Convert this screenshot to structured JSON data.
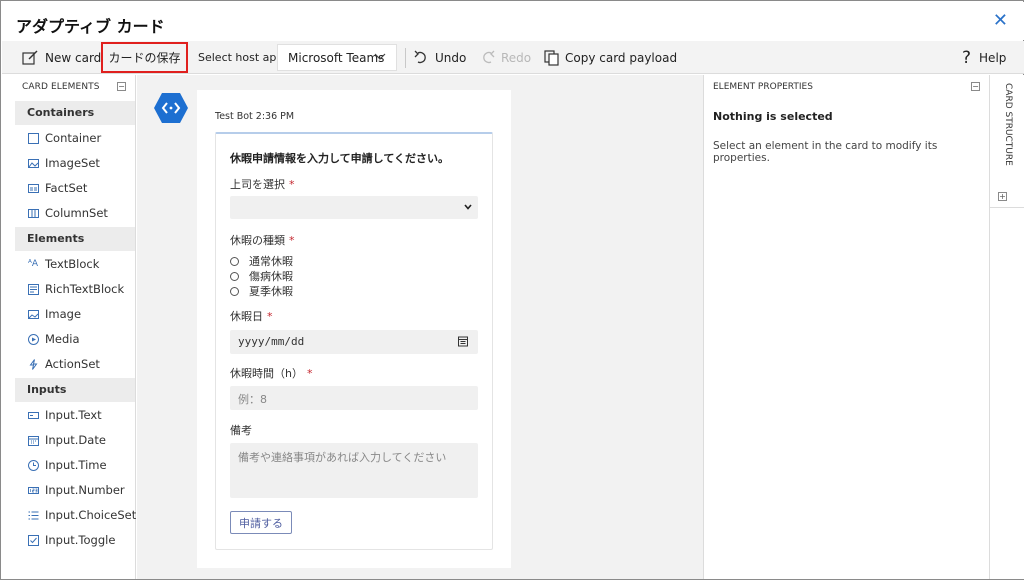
{
  "app": {
    "title": "アダプティブ カード"
  },
  "toolbar": {
    "new_card": "New card",
    "save_card": "カードの保存",
    "host_label": "Select host app:",
    "host_value": "Microsoft Teams",
    "undo": "Undo",
    "redo": "Redo",
    "copy_payload": "Copy card payload",
    "help": "Help"
  },
  "card_elements": {
    "header": "CARD ELEMENTS",
    "groups": [
      {
        "label": "Containers",
        "items": [
          "Container",
          "ImageSet",
          "FactSet",
          "ColumnSet"
        ]
      },
      {
        "label": "Elements",
        "items": [
          "TextBlock",
          "RichTextBlock",
          "Image",
          "Media",
          "ActionSet"
        ]
      },
      {
        "label": "Inputs",
        "items": [
          "Input.Text",
          "Input.Date",
          "Input.Time",
          "Input.Number",
          "Input.ChoiceSet",
          "Input.Toggle"
        ]
      }
    ]
  },
  "message": {
    "meta": "Test Bot 2:36 PM"
  },
  "card": {
    "title": "休暇申請情報を入力して申請してください。",
    "required_mark": "*",
    "manager_label": "上司を選択",
    "type_label": "休暇の種類",
    "type_options": [
      "通常休暇",
      "傷病休暇",
      "夏季休暇"
    ],
    "date_label": "休暇日",
    "date_placeholder": "yyyy/mm/dd",
    "hours_label": "休暇時間（h）",
    "hours_placeholder": "例：8",
    "notes_label": "備考",
    "notes_placeholder": "備考や連絡事項があれば入力してください",
    "submit": "申請する"
  },
  "properties": {
    "header": "ELEMENT PROPERTIES",
    "title": "Nothing is selected",
    "description": "Select an element in the card to modify its properties."
  },
  "structure": {
    "label": "CARD STRUCTURE"
  },
  "colors": {
    "accent": "#2a72c9",
    "highlight": "#e0201e",
    "required": "#c4262e"
  }
}
